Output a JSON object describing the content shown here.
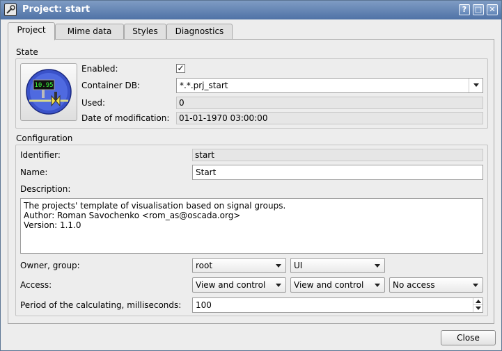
{
  "window": {
    "title": "Project: start"
  },
  "titlebar_buttons": {
    "help": "?",
    "maximize": "□",
    "close": "✕"
  },
  "tabs": [
    {
      "label": "Project"
    },
    {
      "label": "Mime data"
    },
    {
      "label": "Styles"
    },
    {
      "label": "Diagnostics"
    }
  ],
  "state": {
    "header": "State",
    "icon_display": "10.95",
    "enabled_label": "Enabled:",
    "enabled_mark": "✓",
    "container_label": "Container DB:",
    "container_value": "*.*.prj_start",
    "used_label": "Used:",
    "used_value": "0",
    "date_label": "Date of modification:",
    "date_value": "01-01-1970 03:00:00"
  },
  "configuration": {
    "header": "Configuration",
    "identifier_label": "Identifier:",
    "identifier_value": "start",
    "name_label": "Name:",
    "name_value": "Start",
    "description_label": "Description:",
    "description_lines": [
      "The projects' template of visualisation based on signal groups.",
      "Author: Roman Savochenko <rom_as@oscada.org>",
      "Version: 1.1.0"
    ],
    "owner_label": "Owner, group:",
    "owner_value": "root",
    "group_value": "UI",
    "access_label": "Access:",
    "access_user": "View and control",
    "access_group": "View and control",
    "access_other": "No access",
    "period_label": "Period of the calculating, milliseconds:",
    "period_value": "100"
  },
  "footer": {
    "close_label": "Close"
  }
}
